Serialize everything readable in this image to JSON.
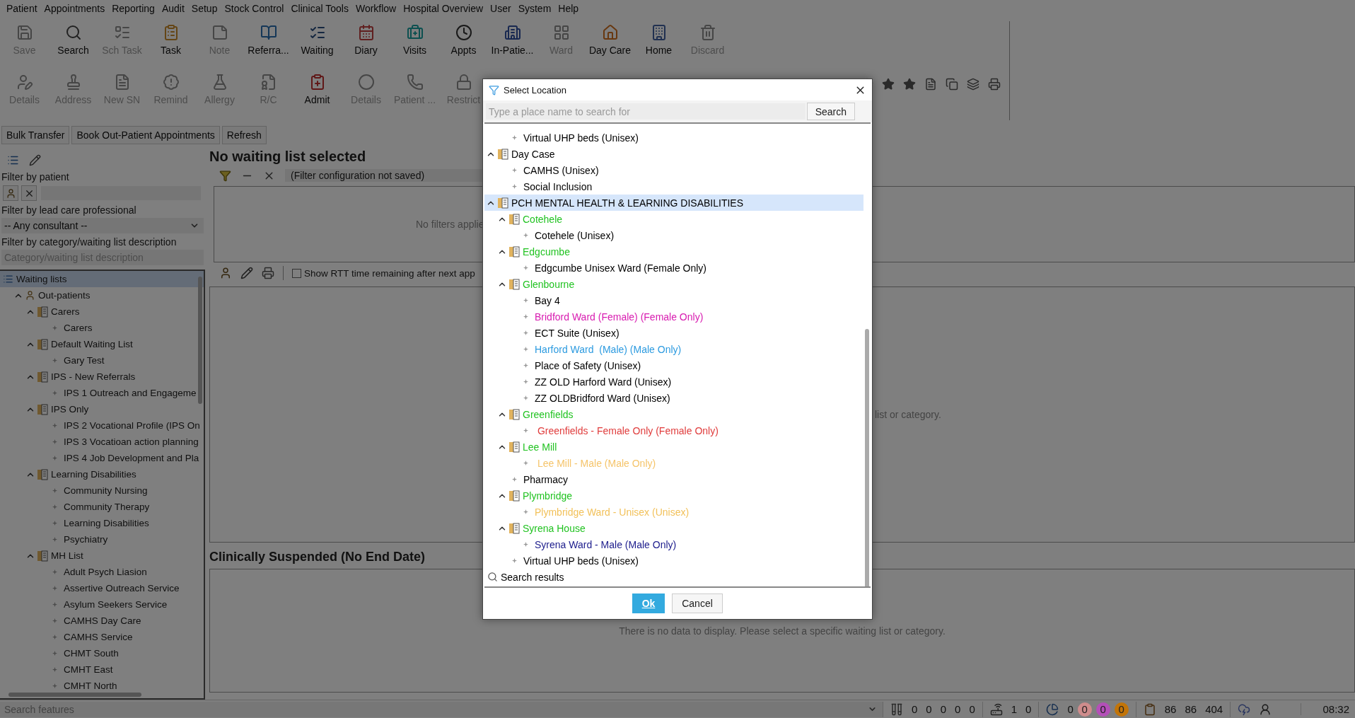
{
  "menu": [
    "Patient",
    "Appointments",
    "Reporting",
    "Audit",
    "Setup",
    "Stock Control",
    "Clinical Tools",
    "Workflow",
    "Hospital Overview",
    "User",
    "System",
    "Help"
  ],
  "toolbar": {
    "rows": [
      [
        {
          "label": "Save",
          "disabled": true
        },
        {
          "label": "Search",
          "disabled": false
        },
        {
          "label": "Sch Task",
          "disabled": true
        },
        {
          "label": "Task",
          "disabled": false
        },
        {
          "label": "Note",
          "disabled": true
        },
        {
          "label": "Referra...",
          "disabled": false
        },
        {
          "label": "Waiting",
          "disabled": false
        },
        {
          "label": "Diary",
          "disabled": false
        },
        {
          "label": "Visits",
          "disabled": false
        },
        {
          "label": "Appts",
          "disabled": false
        },
        {
          "label": "In-Patie...",
          "disabled": false
        },
        {
          "label": "Ward",
          "disabled": true
        },
        {
          "label": "Day Care",
          "disabled": false
        },
        {
          "label": "Home",
          "disabled": false
        },
        {
          "label": "Discard",
          "disabled": true
        }
      ],
      [
        {
          "label": "Details",
          "disabled": true
        },
        {
          "label": "Address",
          "disabled": true
        },
        {
          "label": "New SN",
          "disabled": true
        },
        {
          "label": "Remind",
          "disabled": true
        },
        {
          "label": "Allergy",
          "disabled": true
        },
        {
          "label": "R/C",
          "disabled": true
        },
        {
          "label": "Admit",
          "disabled": false
        },
        {
          "label": "Details",
          "disabled": true
        },
        {
          "label": "Patient ...",
          "disabled": true
        },
        {
          "label": "Restrict",
          "disabled": true
        }
      ]
    ]
  },
  "action_buttons": [
    "Bulk Transfer",
    "Book Out-Patient Appointments",
    "Refresh"
  ],
  "left_panel": {
    "patient_filter_label": "Filter by patient",
    "professional_filter_label": "Filter by lead care professional",
    "professional_value": "-- Any consultant --",
    "category_filter_label": "Filter by category/waiting list description",
    "category_placeholder": "Category/waiting list description",
    "tree": [
      {
        "kind": "list",
        "label": "Waiting lists",
        "selected": true,
        "children": [
          {
            "kind": "patients",
            "label": "Out-patients",
            "selected": false,
            "expanded": true,
            "children": [
              {
                "kind": "group",
                "label": "Carers",
                "selected": false,
                "expanded": true,
                "children": [
                  {
                    "kind": "leaf",
                    "label": "Carers",
                    "selected": false
                  }
                ]
              },
              {
                "kind": "group",
                "label": "Default Waiting List",
                "selected": false,
                "expanded": true,
                "children": [
                  {
                    "kind": "leaf",
                    "label": "Gary Test",
                    "selected": false
                  }
                ]
              },
              {
                "kind": "group",
                "label": "IPS - New Referrals",
                "selected": false,
                "expanded": true,
                "children": [
                  {
                    "kind": "leaf",
                    "label": "IPS 1 Outreach and Engageme",
                    "selected": false
                  }
                ]
              },
              {
                "kind": "group",
                "label": "IPS Only",
                "selected": false,
                "expanded": true,
                "children": [
                  {
                    "kind": "leaf",
                    "label": "IPS 2 Vocational Profile (IPS On",
                    "selected": false
                  },
                  {
                    "kind": "leaf",
                    "label": "IPS 3 Vocatioan action planning",
                    "selected": false
                  },
                  {
                    "kind": "leaf",
                    "label": "IPS 4 Job Development and Pla",
                    "selected": false
                  }
                ]
              },
              {
                "kind": "group",
                "label": "Learning Disabilities",
                "selected": false,
                "expanded": true,
                "children": [
                  {
                    "kind": "leaf",
                    "label": "Community Nursing",
                    "selected": false
                  },
                  {
                    "kind": "leaf",
                    "label": "Community Therapy",
                    "selected": false
                  },
                  {
                    "kind": "leaf",
                    "label": "Learning Disabilities",
                    "selected": false
                  },
                  {
                    "kind": "leaf",
                    "label": "Psychiatry",
                    "selected": false
                  }
                ]
              },
              {
                "kind": "group",
                "label": "MH List",
                "selected": false,
                "expanded": true,
                "children": [
                  {
                    "kind": "leaf",
                    "label": "Adult Psych Liasion",
                    "selected": false
                  },
                  {
                    "kind": "leaf",
                    "label": "Assertive Outreach Service",
                    "selected": false
                  },
                  {
                    "kind": "leaf",
                    "label": "Asylum Seekers Service",
                    "selected": false
                  },
                  {
                    "kind": "leaf",
                    "label": "CAMHS Day Care",
                    "selected": false
                  },
                  {
                    "kind": "leaf",
                    "label": "CAMHS Service",
                    "selected": false
                  },
                  {
                    "kind": "leaf",
                    "label": "CHMT South",
                    "selected": false
                  },
                  {
                    "kind": "leaf",
                    "label": "CMHT East",
                    "selected": false
                  },
                  {
                    "kind": "leaf",
                    "label": "CMHT North",
                    "selected": false
                  }
                ]
              }
            ]
          }
        ]
      }
    ]
  },
  "main": {
    "title": "No waiting list selected",
    "filter_status": "(Filter configuration not saved)",
    "filter_message": "No filters applie",
    "rtt_checkbox": {
      "label": "Show RTT time remaining after next app",
      "checked": false
    },
    "panel_message": "list or category.",
    "suspended_title": "Clinically Suspended (No End Date)",
    "suspended_message": "There is no data to display. Please select a specific waiting list or category."
  },
  "dialog": {
    "title": "Select Location",
    "search_placeholder": "Type a place name to search for",
    "search_button": "Search",
    "tree": [
      {
        "kind": "hidden",
        "children": [
          {
            "kind": "leaf",
            "label": "Virtual UHP beds (Unisex)",
            "color": "#000000",
            "selected": false
          }
        ]
      },
      {
        "kind": "group",
        "label": "Day Case",
        "color": "#000000",
        "selected": false,
        "expanded": true,
        "children": [
          {
            "kind": "leaf",
            "label": "CAMHS (Unisex)",
            "color": "#000000",
            "selected": false
          },
          {
            "kind": "leaf",
            "label": "Social Inclusion",
            "color": "#000000",
            "selected": false
          }
        ]
      },
      {
        "kind": "group",
        "label": "PCH MENTAL HEALTH & LEARNING DISABILITIES",
        "color": "#000000",
        "selected": true,
        "expanded": true,
        "children": [
          {
            "kind": "group",
            "label": "Cotehele",
            "color": "#22c322",
            "selected": false,
            "expanded": true,
            "children": [
              {
                "kind": "leaf",
                "label": "Cotehele (Unisex)",
                "color": "#000000",
                "selected": false
              }
            ]
          },
          {
            "kind": "group",
            "label": "Edgcumbe",
            "color": "#22c322",
            "selected": false,
            "expanded": true,
            "children": [
              {
                "kind": "leaf",
                "label": "Edgcumbe Unisex Ward (Female Only)",
                "color": "#000000",
                "selected": false
              }
            ]
          },
          {
            "kind": "group",
            "label": "Glenbourne",
            "color": "#22c322",
            "selected": false,
            "expanded": true,
            "children": [
              {
                "kind": "leaf",
                "label": "Bay 4",
                "color": "#000000",
                "selected": false
              },
              {
                "kind": "leaf",
                "label": "Bridford Ward (Female) (Female Only)",
                "color": "#d81bb0",
                "selected": false
              },
              {
                "kind": "leaf",
                "label": "ECT Suite (Unisex)",
                "color": "#000000",
                "selected": false
              },
              {
                "kind": "leaf",
                "label": "Harford Ward  (Male) (Male Only)",
                "color": "#2d9be0",
                "selected": false
              },
              {
                "kind": "leaf",
                "label": "Place of Safety (Unisex)",
                "color": "#000000",
                "selected": false
              },
              {
                "kind": "leaf",
                "label": "ZZ OLD Harford Ward (Unisex)",
                "color": "#000000",
                "selected": false
              },
              {
                "kind": "leaf",
                "label": "ZZ OLDBridford Ward (Unisex)",
                "color": "#000000",
                "selected": false
              }
            ]
          },
          {
            "kind": "group",
            "label": "Greenfields",
            "color": "#22c322",
            "selected": false,
            "expanded": true,
            "children": [
              {
                "kind": "leaf",
                "label": " Greenfields - Female Only (Female Only)",
                "color": "#e03c3c",
                "selected": false
              }
            ]
          },
          {
            "kind": "group",
            "label": "Lee Mill",
            "color": "#22c322",
            "selected": false,
            "expanded": true,
            "children": [
              {
                "kind": "leaf",
                "label": " Lee Mill - Male (Male Only)",
                "color": "#f5c46a",
                "selected": false
              }
            ]
          },
          {
            "kind": "leaf",
            "label": "Pharmacy",
            "color": "#000000",
            "selected": false
          },
          {
            "kind": "group",
            "label": "Plymbridge",
            "color": "#22c322",
            "selected": false,
            "expanded": true,
            "children": [
              {
                "kind": "leaf",
                "label": "Plymbridge Ward - Unisex (Unisex)",
                "color": "#f2c15a",
                "selected": false
              }
            ]
          },
          {
            "kind": "group",
            "label": "Syrena House",
            "color": "#22c322",
            "selected": false,
            "expanded": true,
            "children": [
              {
                "kind": "leaf",
                "label": "Syrena Ward - Male (Male Only)",
                "color": "#1c1c8c",
                "selected": false
              }
            ]
          },
          {
            "kind": "leaf",
            "label": "Virtual UHP beds (Unisex)",
            "color": "#000000",
            "selected": false
          }
        ]
      },
      {
        "kind": "search",
        "label": "Search results",
        "color": "#000000",
        "selected": false
      }
    ],
    "ok_button": "Ok",
    "cancel_button": "Cancel"
  },
  "status_bar": {
    "search_placeholder": "Search features",
    "groups": [
      {
        "values": [
          "0",
          "0",
          "0",
          "0",
          "0"
        ]
      },
      {
        "values": [
          "1",
          "0"
        ]
      },
      {
        "values": [
          "0"
        ],
        "badges": [
          {
            "text": "0",
            "color": "#cf8c8c"
          },
          {
            "text": "0",
            "color": "#b44fb8"
          },
          {
            "text": "0",
            "color": "#c27408"
          }
        ]
      },
      {
        "values": [
          "86",
          "86",
          "404"
        ]
      }
    ],
    "time": "08:32"
  }
}
